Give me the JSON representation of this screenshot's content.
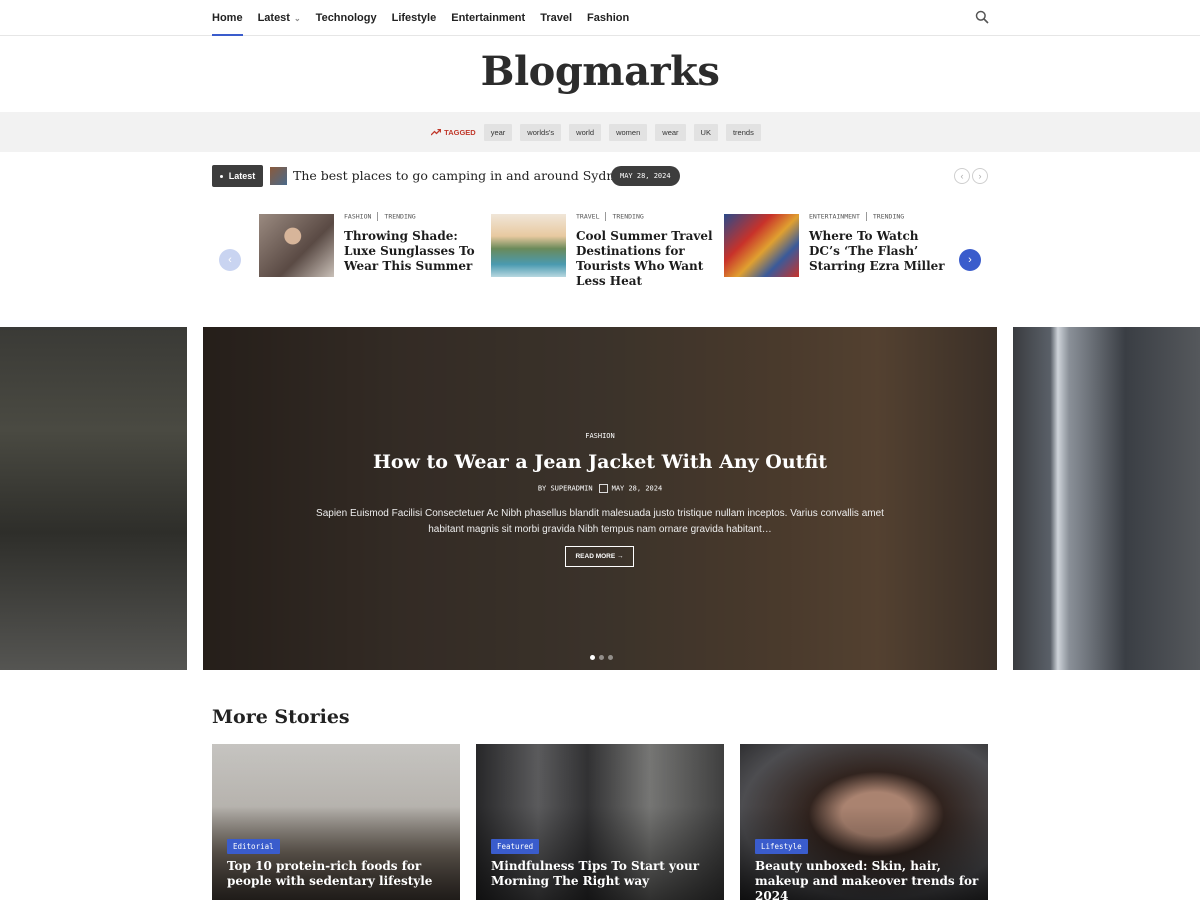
{
  "nav": {
    "items": [
      {
        "label": "Home",
        "active": true
      },
      {
        "label": "Latest",
        "caret": true
      },
      {
        "label": "Technology"
      },
      {
        "label": "Lifestyle"
      },
      {
        "label": "Entertainment"
      },
      {
        "label": "Travel"
      },
      {
        "label": "Fashion"
      }
    ],
    "search_icon": "search-icon"
  },
  "site": {
    "title": "Blogmarks"
  },
  "tags": {
    "label": "TAGGED",
    "items": [
      "year",
      "worlds's",
      "world",
      "women",
      "wear",
      "UK",
      "trends"
    ]
  },
  "ticker": {
    "badge": "Latest",
    "title": "The best places to go camping in and around Sydney",
    "date": "MAY 28, 2024",
    "prev_icon": "chevron-left-icon",
    "next_icon": "chevron-right-icon"
  },
  "mini_posts": [
    {
      "category": "FASHION",
      "tag": "TRENDING",
      "title": "Throwing Shade: Luxe Sunglasses To Wear This Summer"
    },
    {
      "category": "TRAVEL",
      "tag": "TRENDING",
      "title": "Cool Summer Travel Destinations for Tourists Who Want Less Heat"
    },
    {
      "category": "ENTERTAINMENT",
      "tag": "TRENDING",
      "title": "Where To Watch DC’s ‘The Flash’ Starring Ezra Miller"
    }
  ],
  "hero": {
    "category": "FASHION",
    "title": "How to Wear a Jean Jacket With Any Outfit",
    "author": "BY SUPERADMIN",
    "date": "MAY 28, 2024",
    "excerpt": "Sapien Euismod Facilisi Consectetuer Ac Nibh phasellus blandit malesuada justo tristique nullam inceptos. Varius convallis amet habitant magnis sit morbi gravida Nibh tempus nam ornare gravida habitant…",
    "read_more": "READ MORE →",
    "slide_count": 3,
    "active_slide": 1
  },
  "more_stories": {
    "title": "More Stories",
    "items": [
      {
        "badge": "Editorial",
        "title": "Top 10 protein-rich foods for people with sedentary lifestyle"
      },
      {
        "badge": "Featured",
        "title": "Mindfulness Tips To Start your Morning The Right way"
      },
      {
        "badge": "Lifestyle",
        "title": "Beauty unboxed: Skin, hair, makeup and makeover trends for 2024"
      }
    ]
  },
  "colors": {
    "accent": "#3a5ccc",
    "tag_label": "#c0392b",
    "dark_badge": "#3d3d3d"
  }
}
